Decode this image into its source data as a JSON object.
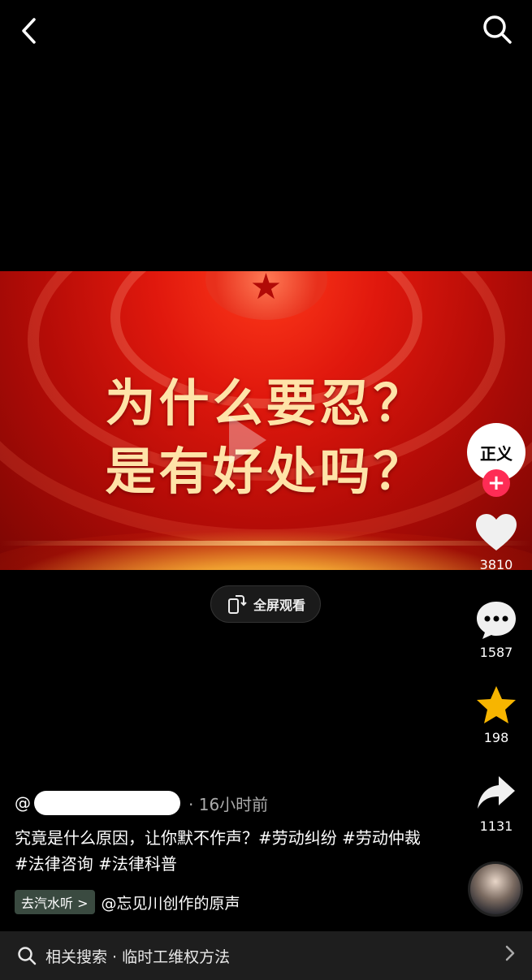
{
  "top_bar": {
    "back_icon": "chevron-left-icon",
    "search_icon": "search-icon"
  },
  "video": {
    "title_line1": "为什么要忍？",
    "title_line2": "是有好处吗？",
    "fullscreen_label": "全屏观看"
  },
  "rail": {
    "avatar_text": "正义",
    "follow_symbol": "+",
    "likes": "3810",
    "comments": "1587",
    "favorites": "198",
    "shares": "1131"
  },
  "post": {
    "at_symbol": "@",
    "time": "· 16小时前",
    "description": "究竟是什么原因，让你默不作声？#劳动纠纷 #劳动仲裁 #法律咨询 #法律科普",
    "listen_button": "去汽水听 >",
    "sound": "@忘见川创作的原声"
  },
  "related_search": {
    "text": "相关搜索 · 临时工维权方法"
  },
  "colors": {
    "accent": "#fe2c55",
    "star": "#f7b500"
  }
}
